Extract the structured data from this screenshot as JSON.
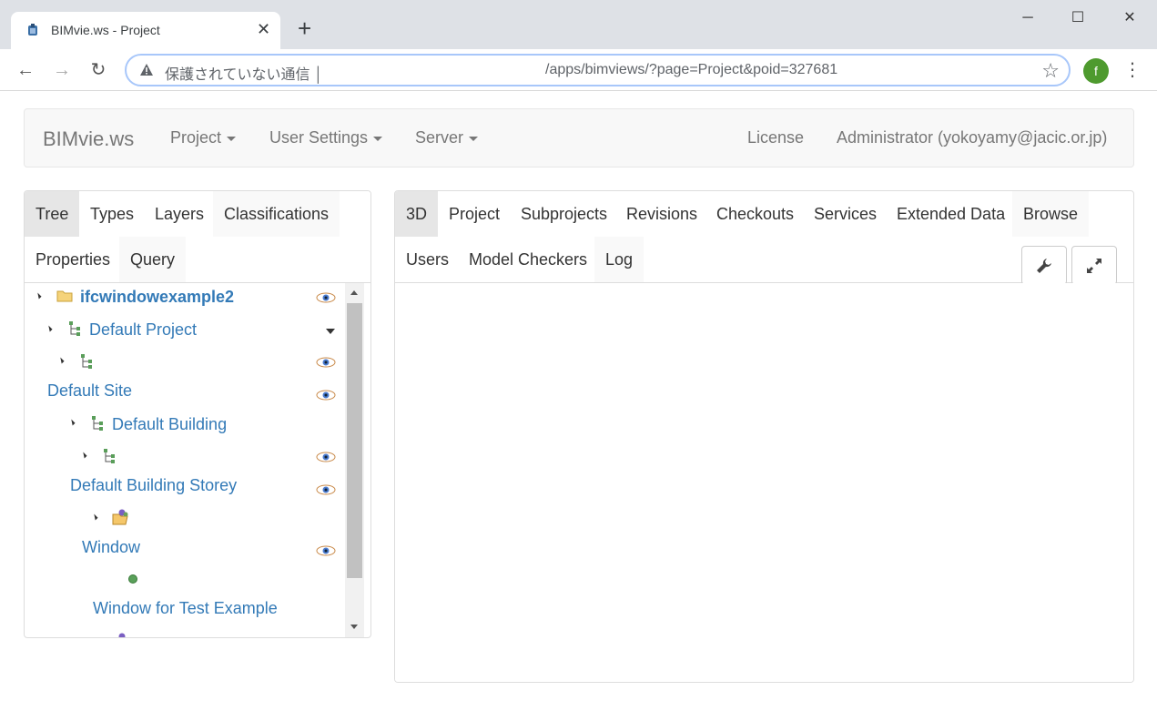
{
  "browser": {
    "tab_title": "BIMvie.ws - Project",
    "close_glyph": "✕",
    "new_tab_glyph": "+",
    "minimize_glyph": "─",
    "maximize_glyph": "☐",
    "close_window_glyph": "✕",
    "back_glyph": "←",
    "forward_glyph": "→",
    "reload_glyph": "↻",
    "security_text": "保護されていない通信 │",
    "url": "/apps/bimviews/?page=Project&poid=327681",
    "star_glyph": "☆",
    "avatar_letter": "f",
    "menu_glyph": "⋮"
  },
  "navbar": {
    "brand": "BIMvie.ws",
    "items": [
      {
        "label": "Project",
        "dropdown": true
      },
      {
        "label": "User Settings",
        "dropdown": true
      },
      {
        "label": "Server",
        "dropdown": true
      }
    ],
    "license": "License",
    "user": "Administrator (yokoyamy@jacic.or.jp)"
  },
  "left_tabs": {
    "tree": "Tree",
    "types": "Types",
    "layers": "Layers",
    "classifications": "Classifications",
    "properties": "Properties",
    "query": "Query",
    "active": "Tree"
  },
  "tree": {
    "root": "ifcwindowexample2",
    "project": "Default Project",
    "site": "Default Site",
    "building": "Default Building",
    "storey": "Default Building Storey",
    "window_group": "Window",
    "window_item": "Window for Test Example"
  },
  "right_tabs": {
    "t3d": "3D",
    "project": "Project",
    "subprojects": "Subprojects",
    "revisions": "Revisions",
    "checkouts": "Checkouts",
    "services": "Services",
    "extended_data": "Extended Data",
    "browse": "Browse",
    "users": "Users",
    "model_checkers": "Model Checkers",
    "log": "Log",
    "active": "3D"
  },
  "colors": {
    "link": "#337ab7",
    "navbar_bg": "#f8f8f8",
    "active_tab_bg": "#e6e6e6",
    "avatar_bg": "#4e9a2e"
  },
  "icons": {
    "folder": "folder-icon",
    "hierarchy": "hierarchy-icon",
    "eye": "eye-icon",
    "wrench": "wrench-icon",
    "expand": "expand-icon"
  }
}
